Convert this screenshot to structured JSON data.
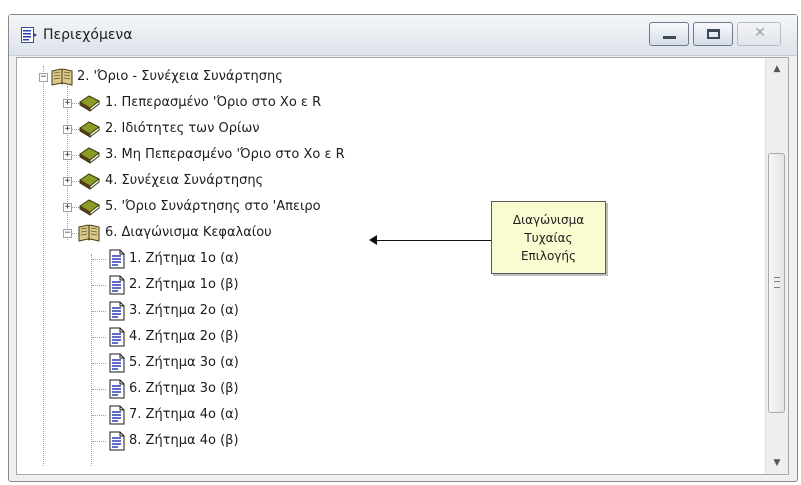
{
  "window": {
    "title": "Περιεχόμενα"
  },
  "tree": {
    "root": {
      "label": "2. 'Όριο - Συνέχεια Συνάρτησης"
    },
    "chapters": [
      {
        "label": "1.  Πεπερασμένο 'Όριο στο Xο ε R"
      },
      {
        "label": "2.  Ιδιότητες των Ορίων"
      },
      {
        "label": "3.  Μη Πεπερασμένο 'Όριο στο Xο ε R"
      },
      {
        "label": "4.  Συνέχεια Συνάρτησης"
      },
      {
        "label": "5.  'Όριο Συνάρτησης στο 'Απειρο"
      }
    ],
    "open_chapter": {
      "label": "6.  Διαγώνισμα Κεφαλαίου"
    },
    "items": [
      {
        "label": "1.  Ζήτημα 1ο (α)"
      },
      {
        "label": "2.  Ζήτημα 1ο (β)"
      },
      {
        "label": "3.  Ζήτημα 2ο (α)"
      },
      {
        "label": "4.  Ζήτημα 2ο (β)"
      },
      {
        "label": "5.  Ζήτημα 3ο (α)"
      },
      {
        "label": "6.  Ζήτημα 3ο (β)"
      },
      {
        "label": "7.  Ζήτημα 4ο (α)"
      },
      {
        "label": "8.  Ζήτημα 4ο (β)"
      }
    ]
  },
  "callout": {
    "line1": "Διαγώνισμα",
    "line2": "Τυχαίας",
    "line3": "Επιλογής"
  },
  "window_buttons": {
    "close_glyph": "✕"
  },
  "scrollbar": {
    "up_glyph": "▲",
    "down_glyph": "▼"
  },
  "colors": {
    "book_closed": "#7a8a1e",
    "book_open": "#8a7a3a",
    "page_lines": "#2a3fb0"
  }
}
